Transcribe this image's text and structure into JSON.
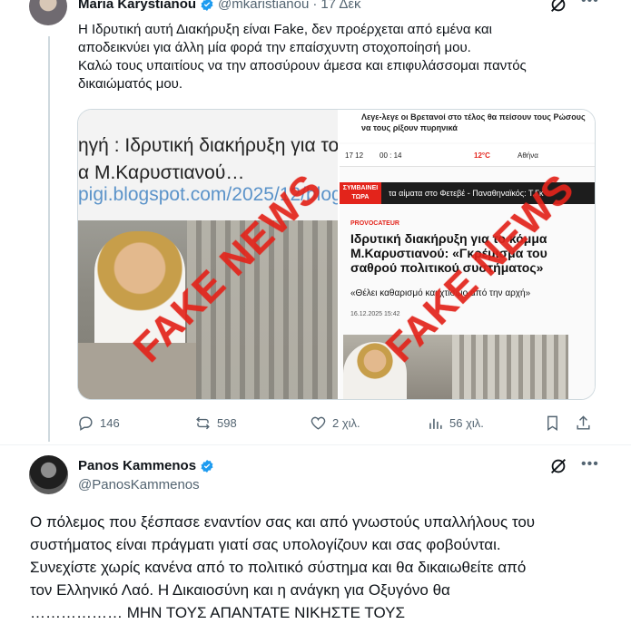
{
  "tweet1": {
    "name": "Maria Karystianou",
    "handle": "@mkaristianou",
    "dot": "·",
    "date": "17 Δεκ",
    "text_lines": [
      "Η Ιδρυτική αυτή Διακήρυξη είναι Fake, δεν προέρχεται από εμένα και",
      "αποδεικνύει για άλλη μία φορά την επαίσχυντη στοχοποίησή μου.",
      "Καλώ τους υπαιτίους να την αποσύρουν άμεσα και επιφυλάσσομαι παντός",
      "δικαιώματός μου."
    ],
    "media_left": {
      "line1": "ηγή  : Ιδρυτική διακήρυξη για το",
      "line2": "α Μ.Καρυστιανού…",
      "line3": "pigi.blogspot.com/2025/12/blog-",
      "stamp": "FAKE NEWS"
    },
    "media_right": {
      "top_text": "Λεγε-λεγε οι Βρετανοί στο τέλος θα πείσουν τους Ρώσους να τους ρίξουν πυρηνικά",
      "bar_left": "17 12",
      "bar_mid": "00 : 14",
      "temp": "12°C",
      "bar_right": "Αθήνα",
      "badge": "ΣΥΜΒΑΙΝΕΙ ΤΩΡΑ",
      "news_text": "τα αίματα στο Φετεβέ - Παναθηναϊκός: Τ.Γκ",
      "category": "PROVOCATEUR",
      "headline": "Ιδρυτική διακήρυξη για το κόμμα Μ.Καρυστιανού: «Γκρέμισμα του σαθρού πολιτικού συστήματος»",
      "quote": "«Θέλει καθαρισμό και χτίσιμο από την αρχή»",
      "date": "16.12.2025 15:42",
      "stamp": "FAKE NEWS"
    },
    "actions": {
      "replies": "146",
      "reposts": "598",
      "likes": "2 χιλ.",
      "views": "56 χιλ."
    }
  },
  "tweet2": {
    "name": "Panos Kammenos",
    "handle": "@PanosKammenos",
    "text_lines": [
      "Ο πόλεμος που ξέσπασε εναντίον σας και από γνωστούς υπαλλήλους του",
      "συστήματος είναι πράγματι γιατί σας υπολογίζουν και σας φοβούνται.",
      "Συνεχίστε χωρίς κανένα από το πολιτικό σύστημα και θα δικαιωθείτε από",
      "τον Ελληνικό Λαό. Η Δικαιοσύνη και η ανάγκη για Οξυγόνο θα",
      "……………… ΜΗΝ ΤΟΥΣ ΑΠΑΝΤΑΤΕ ΝΙΚΗΣΤΕ ΤΟΥΣ"
    ]
  },
  "colors": {
    "verified": "#1d9bf0",
    "secondary_text": "#536471",
    "stamp": "#e3241b"
  },
  "icons": [
    "grok-icon",
    "more-icon",
    "verified-badge-icon",
    "reply-icon",
    "repost-icon",
    "like-icon",
    "views-icon",
    "bookmark-icon",
    "share-icon"
  ]
}
